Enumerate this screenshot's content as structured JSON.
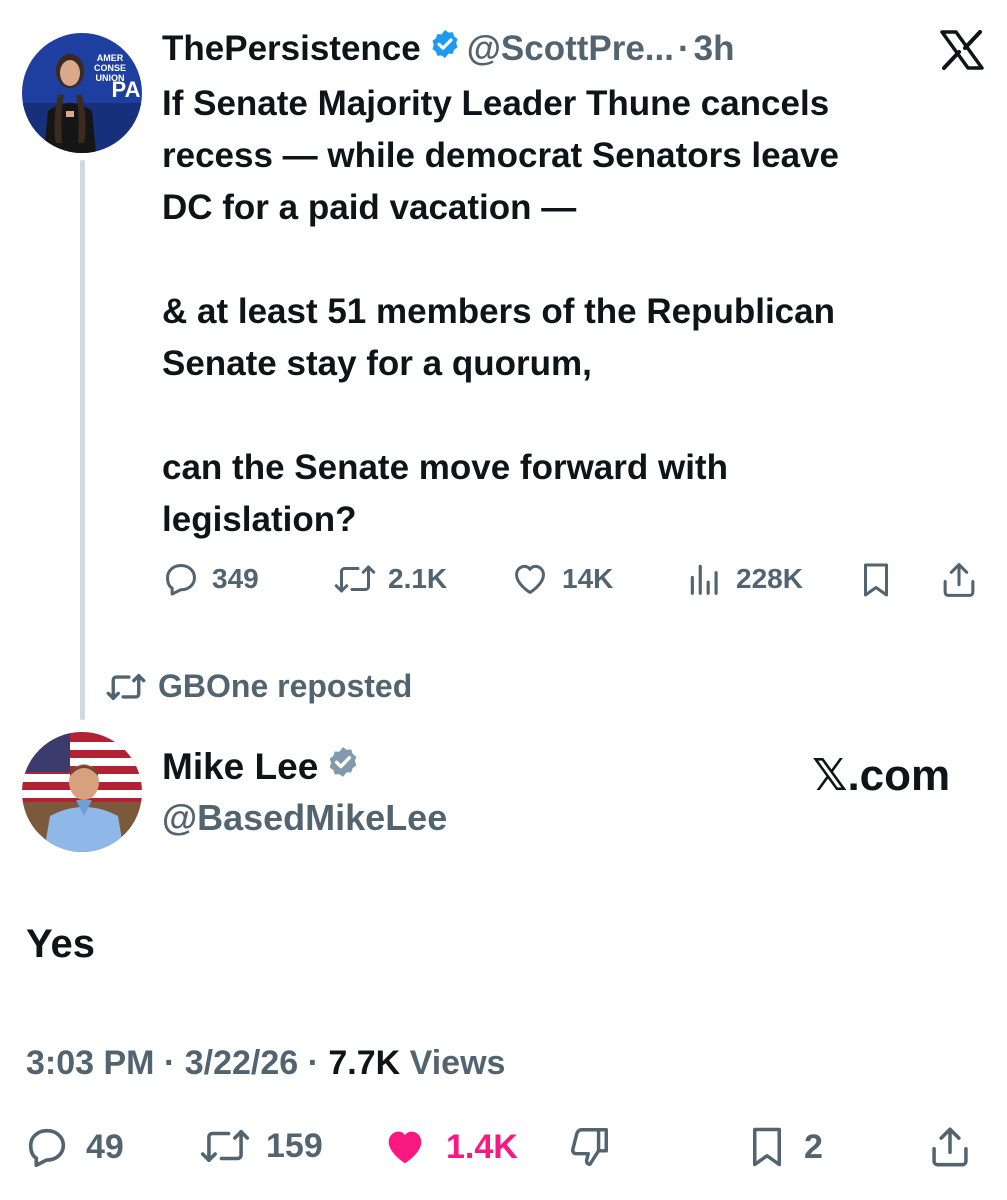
{
  "quoted_tweet": {
    "author_name": "ThePersistence",
    "handle": "@ScottPre...",
    "separator": "·",
    "time": "3h",
    "body_lines": [
      "If Senate Majority Leader Thune cancels",
      "recess — while democrat Senators leave",
      "DC for a paid vacation —",
      "",
      "& at least 51 members of the Republican",
      "Senate stay for a quorum,",
      "",
      "can the Senate move forward with",
      "legislation?"
    ],
    "stats": {
      "replies": "349",
      "reposts": "2.1K",
      "likes": "14K",
      "views": "228K"
    },
    "avatar_text": "AMERICAN CONSERVATIVE UNION CPA"
  },
  "repost_notice": "GBOne reposted",
  "main_tweet": {
    "author_name": "Mike Lee",
    "handle": "@BasedMikeLee",
    "brand": "𝕏.com",
    "text": "Yes",
    "meta": {
      "time": "3:03 PM",
      "sep1": " · ",
      "date": "3/22/26",
      "sep2": " · ",
      "views_count": "7.7K",
      "views_label": " Views"
    },
    "stats": {
      "replies": "49",
      "reposts": "159",
      "likes": "1.4K",
      "bookmarks": "2"
    }
  },
  "colors": {
    "text": "#0f1419",
    "muted": "#536471",
    "verified": "#1d9bf0",
    "verified_gray": "#829aab",
    "like": "#f91880",
    "thread_line": "#cfd9de"
  }
}
